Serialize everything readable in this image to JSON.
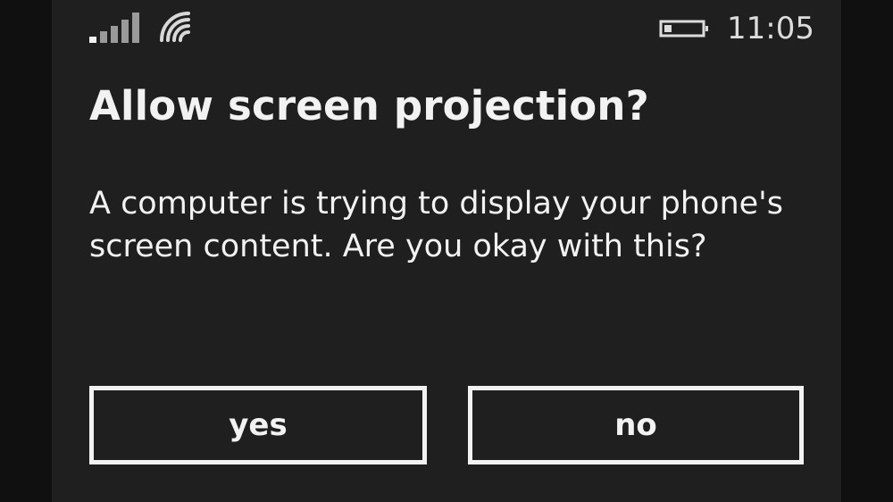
{
  "status_bar": {
    "signal_icon": "cellular-signal-icon",
    "wifi_icon": "wifi-icon",
    "battery_icon": "battery-icon",
    "time": "11:05"
  },
  "dialog": {
    "title": "Allow screen projection?",
    "message": "A computer is trying to display your phone's screen content. Are you okay with this?",
    "yes_label": "yes",
    "no_label": "no"
  }
}
